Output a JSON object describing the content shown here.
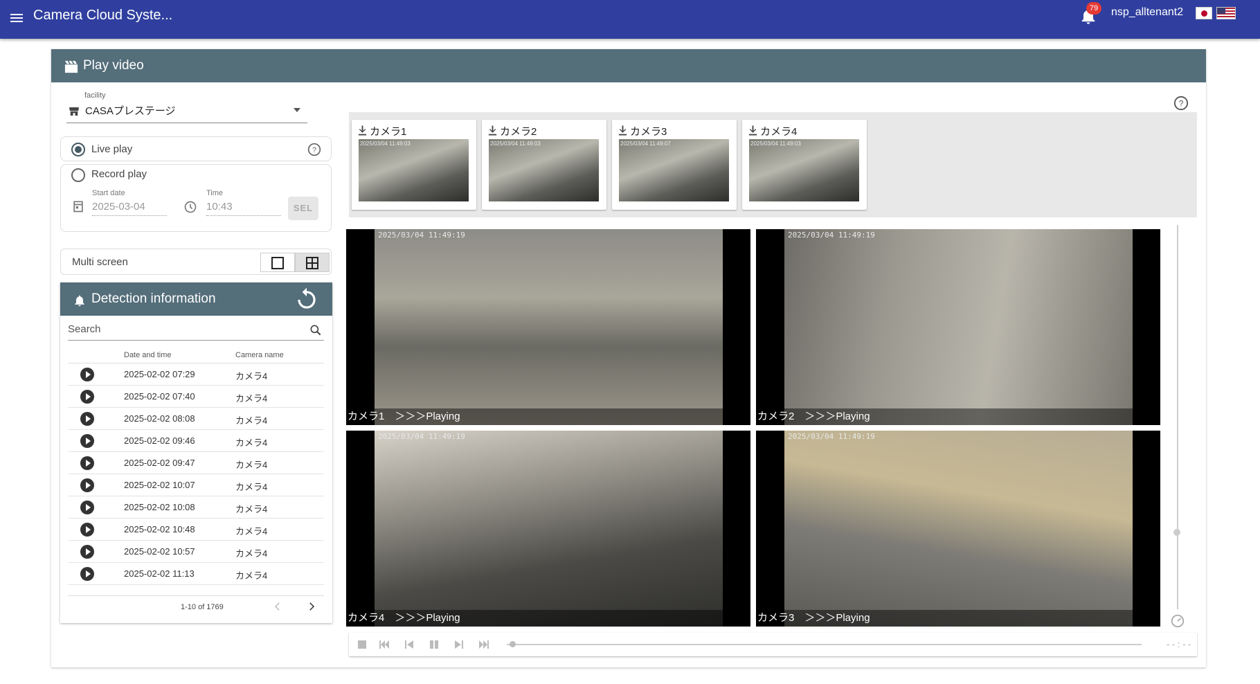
{
  "app": {
    "title": "Camera Cloud Syste...",
    "notification_count": "79",
    "username": "nsp_alltenant2"
  },
  "card": {
    "title": "Play video"
  },
  "facility": {
    "label": "facility",
    "value": "CASAプレステージ"
  },
  "play_mode": {
    "live_label": "Live play",
    "record_label": "Record play",
    "start_date_label": "Start date",
    "start_date_value": "2025-03-04",
    "time_label": "Time",
    "time_value": "10:43",
    "sel_label": "SEL"
  },
  "multi_screen": {
    "label": "Multi screen"
  },
  "detection": {
    "title": "Detection information",
    "search_placeholder": "Search",
    "col_date": "Date and time",
    "col_camera": "Camera name",
    "rows": [
      {
        "datetime": "2025-02-02 07:29",
        "camera": "カメラ4"
      },
      {
        "datetime": "2025-02-02 07:40",
        "camera": "カメラ4"
      },
      {
        "datetime": "2025-02-02 08:08",
        "camera": "カメラ4"
      },
      {
        "datetime": "2025-02-02 09:46",
        "camera": "カメラ4"
      },
      {
        "datetime": "2025-02-02 09:47",
        "camera": "カメラ4"
      },
      {
        "datetime": "2025-02-02 10:07",
        "camera": "カメラ4"
      },
      {
        "datetime": "2025-02-02 10:08",
        "camera": "カメラ4"
      },
      {
        "datetime": "2025-02-02 10:48",
        "camera": "カメラ4"
      },
      {
        "datetime": "2025-02-02 10:57",
        "camera": "カメラ4"
      },
      {
        "datetime": "2025-02-02 11:13",
        "camera": "カメラ4"
      }
    ],
    "pagination": "1-10 of 1769"
  },
  "thumbnails": [
    {
      "name": "カメラ1",
      "timestamp": "2025/03/04 11:49:03"
    },
    {
      "name": "カメラ2",
      "timestamp": "2025/03/04 11:49:03"
    },
    {
      "name": "カメラ3",
      "timestamp": "2025/03/04 11:49:07"
    },
    {
      "name": "カメラ4",
      "timestamp": "2025/03/04 11:49:03"
    }
  ],
  "videos": [
    {
      "caption": "カメラ1　＞＞＞Playing",
      "timestamp": "2025/03/04 11:49:19"
    },
    {
      "caption": "カメラ2　＞＞＞Playing",
      "timestamp": "2025/03/04 11:49:19"
    },
    {
      "caption": "カメラ4　＞＞＞Playing",
      "timestamp": "2025/03/04 11:49:19"
    },
    {
      "caption": "カメラ3　＞＞＞Playing",
      "timestamp": "2025/03/04 11:49:19"
    }
  ],
  "playback": {
    "time": "- - : - -"
  },
  "colors": {
    "appbar": "#303f9f",
    "header": "#546e7a",
    "badge": "#e53935"
  },
  "icons": [
    "menu-icon",
    "bell-icon",
    "clapperboard-icon",
    "store-icon",
    "help-icon",
    "calendar-icon",
    "clock-icon",
    "single-screen-icon",
    "grid-screen-icon",
    "refresh-icon",
    "search-icon",
    "download-icon",
    "stop-icon",
    "skip-first-icon",
    "skip-prev-icon",
    "pause-icon",
    "skip-next-icon",
    "skip-last-icon",
    "speed-icon"
  ]
}
